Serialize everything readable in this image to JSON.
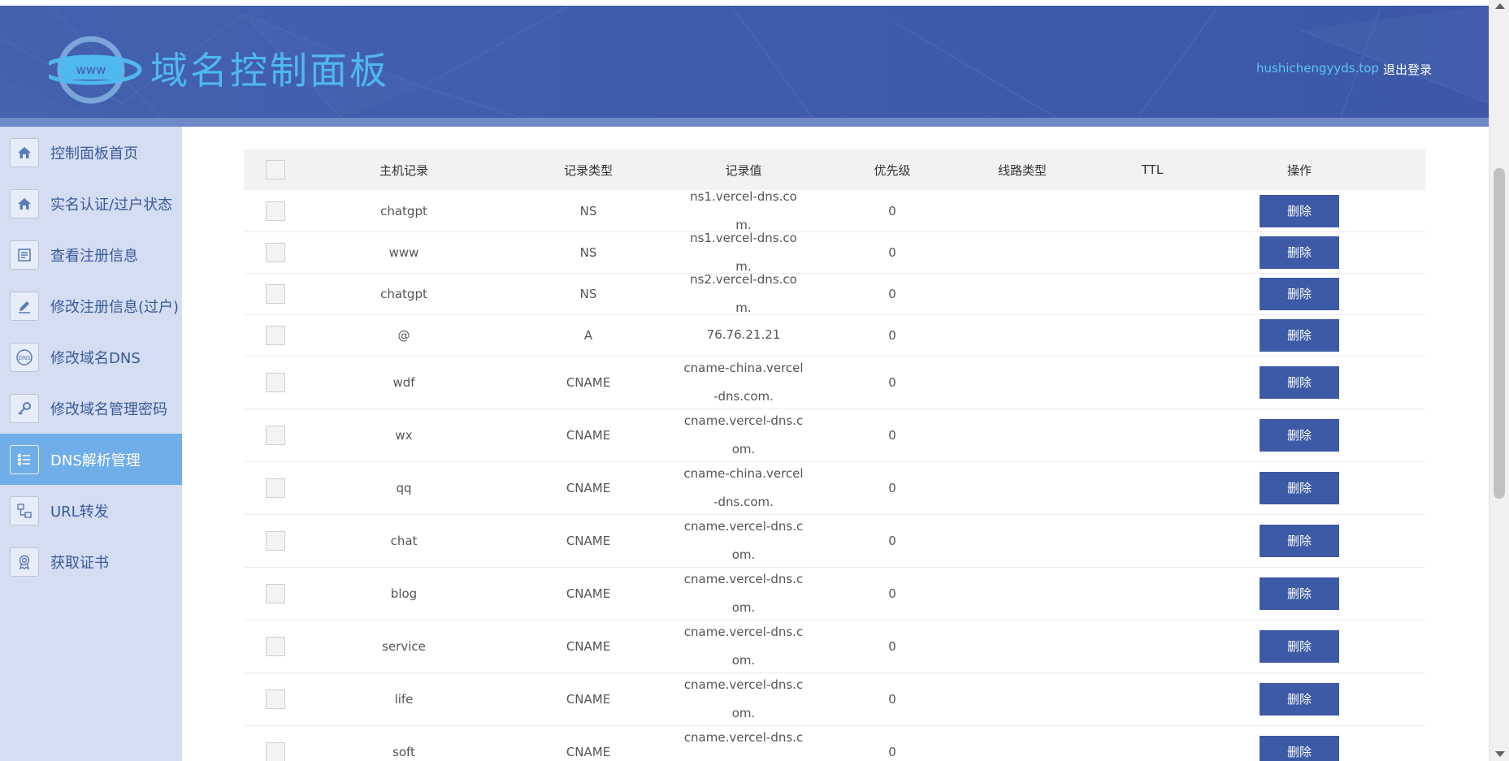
{
  "header": {
    "brand": "域名控制面板",
    "logo_text": "www",
    "user": "hushichengyyds.top",
    "logout": "退出登录"
  },
  "sidebar": {
    "items": [
      {
        "label": "控制面板首页",
        "icon": "home-icon"
      },
      {
        "label": "实名认证/过户状态",
        "icon": "home-icon"
      },
      {
        "label": "查看注册信息",
        "icon": "document-icon"
      },
      {
        "label": "修改注册信息(过户)",
        "icon": "pencil-icon"
      },
      {
        "label": "修改域名DNS",
        "icon": "dns-icon"
      },
      {
        "label": "修改域名管理密码",
        "icon": "key-icon"
      },
      {
        "label": "DNS解析管理",
        "icon": "list-icon",
        "active": true
      },
      {
        "label": "URL转发",
        "icon": "network-icon"
      },
      {
        "label": "获取证书",
        "icon": "certificate-icon"
      }
    ]
  },
  "table": {
    "headers": [
      "主机记录",
      "记录类型",
      "记录值",
      "优先级",
      "线路类型",
      "TTL",
      "操作"
    ],
    "delete_label": "删除",
    "rows": [
      {
        "host": "chatgpt",
        "type": "NS",
        "value": "ns1.vercel-dns.com.",
        "priority": "0"
      },
      {
        "host": "www",
        "type": "NS",
        "value": "ns1.vercel-dns.com.",
        "priority": "0"
      },
      {
        "host": "chatgpt",
        "type": "NS",
        "value": "ns2.vercel-dns.com.",
        "priority": "0"
      },
      {
        "host": "@",
        "type": "A",
        "value": "76.76.21.21",
        "priority": "0"
      },
      {
        "host": "wdf",
        "type": "CNAME",
        "value": "cname-china.vercel-dns.com.",
        "priority": "0"
      },
      {
        "host": "wx",
        "type": "CNAME",
        "value": "cname.vercel-dns.com.",
        "priority": "0"
      },
      {
        "host": "qq",
        "type": "CNAME",
        "value": "cname-china.vercel-dns.com.",
        "priority": "0"
      },
      {
        "host": "chat",
        "type": "CNAME",
        "value": "cname.vercel-dns.com.",
        "priority": "0"
      },
      {
        "host": "blog",
        "type": "CNAME",
        "value": "cname.vercel-dns.com.",
        "priority": "0"
      },
      {
        "host": "service",
        "type": "CNAME",
        "value": "cname.vercel-dns.com.",
        "priority": "0"
      },
      {
        "host": "life",
        "type": "CNAME",
        "value": "cname.vercel-dns.com.",
        "priority": "0"
      },
      {
        "host": "soft",
        "type": "CNAME",
        "value": "cname.vercel-dns.co",
        "priority": "0"
      }
    ]
  },
  "colors": {
    "header_bg": "#3e5caa",
    "brand": "#4fb8ef",
    "sidebar_bg": "#d4ddf2",
    "active": "#6faee9",
    "button": "#3c5aa6"
  }
}
